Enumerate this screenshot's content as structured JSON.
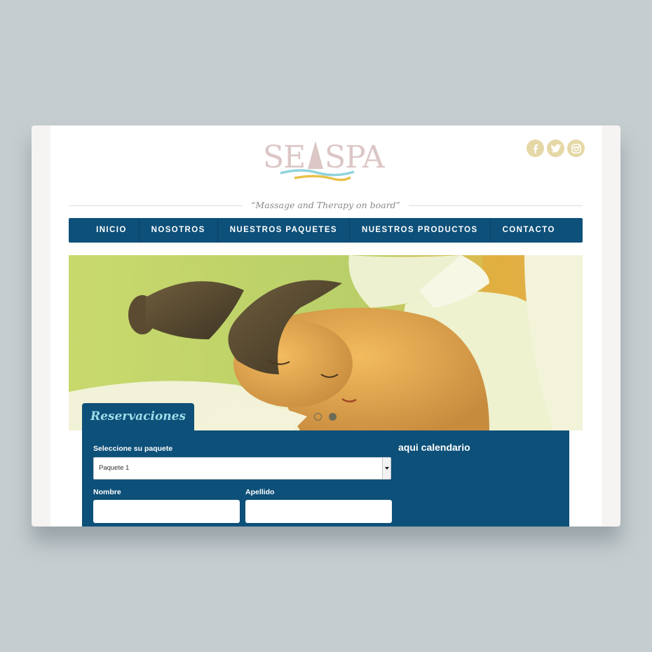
{
  "brand": {
    "name": "SEASPA"
  },
  "social": [
    {
      "icon": "facebook-icon"
    },
    {
      "icon": "twitter-icon"
    },
    {
      "icon": "instagram-icon"
    }
  ],
  "tagline": "“Massage and Therapy on board”",
  "nav": {
    "items": [
      {
        "label": "INICIO"
      },
      {
        "label": "NOSOTROS"
      },
      {
        "label": "NUESTROS PAQUETES"
      },
      {
        "label": "NUESTROS PRODUCTOS"
      },
      {
        "label": "CONTACTO"
      }
    ]
  },
  "hero": {
    "slide_count": 2,
    "active_slide": 2
  },
  "reservations": {
    "title": "Reservaciones",
    "package_label": "Seleccione su paquete",
    "package_value": "Paquete 1",
    "first_name_label": "Nombre",
    "last_name_label": "Apellido",
    "first_name_value": "",
    "last_name_value": "",
    "calendar_text": "aqui calendario"
  },
  "colors": {
    "nav": "#0d5079",
    "accent_title": "#9fdce8",
    "social": "#e6d8a6",
    "logo_text": "#d9c4c4"
  }
}
